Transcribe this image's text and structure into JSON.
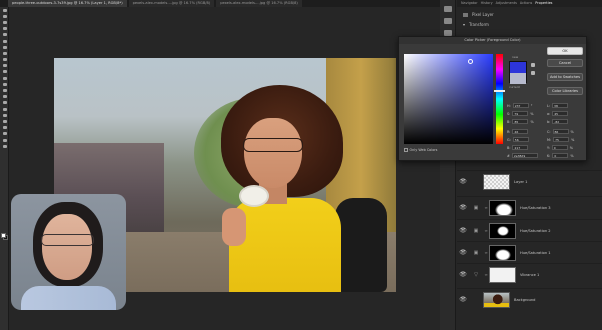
{
  "tabs": [
    "people-three-outdoors-3-7s39.jpg @ 16.7% (Layer 1, RGB/8*)",
    "pexels-alex-models-…jpg @ 16.7% (RGB/8)",
    "pexels-alex-models-…jpg @ 16.7% (RGB/8)"
  ],
  "panel_tabs": [
    "Navigator",
    "History",
    "Adjustments",
    "Actions",
    "Properties"
  ],
  "properties": {
    "row1": "Pixel Layer",
    "row2": "Transform"
  },
  "color_picker": {
    "title": "Color Picker (Foreground Color)",
    "new_label": "new",
    "current_label": "current",
    "ok": "OK",
    "cancel": "Cancel",
    "add_to_swatches": "Add to Swatches",
    "color_libraries": "Color Libraries",
    "only_web_colors": "Only Web Colors",
    "hsb": [
      {
        "label": "H:",
        "value": "237",
        "unit": "°"
      },
      {
        "label": "S:",
        "value": "79",
        "unit": "%"
      },
      {
        "label": "B:",
        "value": "85",
        "unit": "%"
      }
    ],
    "rgb": [
      {
        "label": "R:",
        "value": "46",
        "unit": ""
      },
      {
        "label": "G:",
        "value": "56",
        "unit": ""
      },
      {
        "label": "B:",
        "value": "217",
        "unit": ""
      }
    ],
    "lab": [
      {
        "label": "L:",
        "value": "38",
        "unit": ""
      },
      {
        "label": "a:",
        "value": "45",
        "unit": ""
      },
      {
        "label": "b:",
        "value": "-82",
        "unit": ""
      }
    ],
    "cmyk": [
      {
        "label": "C:",
        "value": "86",
        "unit": "%"
      },
      {
        "label": "M:",
        "value": "75",
        "unit": "%"
      },
      {
        "label": "Y:",
        "value": "0",
        "unit": "%"
      },
      {
        "label": "K:",
        "value": "0",
        "unit": "%"
      }
    ],
    "hex_label": "#",
    "hex": "2e38d9",
    "new_color": "#2d35d9",
    "current_color": "#b6bacd"
  },
  "layers": [
    {
      "name": "Layer 1",
      "mask": false,
      "thumb": "transparent"
    },
    {
      "name": "Hue/Saturation 3",
      "mask": true,
      "thumb": "adjust"
    },
    {
      "name": "Hue/Saturation 2",
      "mask": true,
      "thumb": "adjust"
    },
    {
      "name": "Hue/Saturation 1",
      "mask": true,
      "thumb": "adjust"
    },
    {
      "name": "Vibrance 1",
      "mask": true,
      "thumb": "vibrance"
    },
    {
      "name": "Background",
      "mask": false,
      "thumb": "photo"
    }
  ]
}
